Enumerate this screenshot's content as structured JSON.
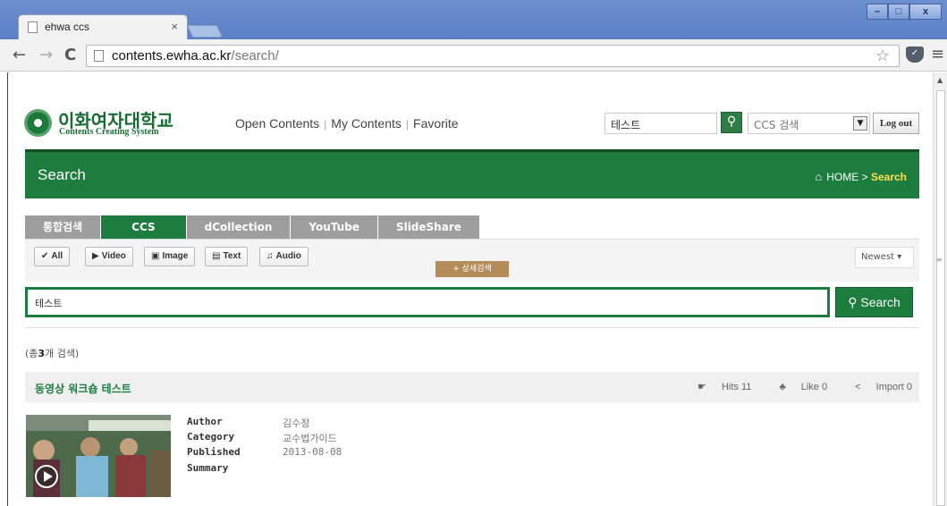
{
  "browser": {
    "tab_title": "ehwa ccs",
    "tab_close": "×",
    "url_host": "contents.ewha.ac.kr",
    "url_path": "/search/",
    "window_min": "–",
    "window_max": "□",
    "window_close": "x",
    "back": "←",
    "forward": "→",
    "reload": "C",
    "star": "☆",
    "menu": "≡"
  },
  "header": {
    "logo_kr": "이화여자대학교",
    "logo_en": "Contents Creating System",
    "nav": [
      "Open Contents",
      "My Contents",
      "Favorite"
    ],
    "search_value": "테스트",
    "select_value": "CCS 검색",
    "logout": "Log out"
  },
  "banner": {
    "title": "Search",
    "crumb_home": "HOME",
    "crumb_sep": ">",
    "crumb_current": "Search"
  },
  "tabs": [
    "통합검색",
    "CCS",
    "dCollection",
    "YouTube",
    "SlideShare"
  ],
  "active_tab": "CCS",
  "filters": [
    {
      "icon": "✔",
      "label": "All"
    },
    {
      "icon": "▶",
      "label": "Video"
    },
    {
      "icon": "▣",
      "label": "Image"
    },
    {
      "icon": "▤",
      "label": "Text"
    },
    {
      "icon": "♫",
      "label": "Audio"
    }
  ],
  "sort": "Newest",
  "detail_search": "+ 상세검색",
  "search": {
    "value": "테스트",
    "button": "Search"
  },
  "result_count": {
    "prefix": "(총",
    "count": "3",
    "suffix": "개 검색)"
  },
  "result": {
    "title": "동영상 워크숍 테스트",
    "hits": "Hits 11",
    "like": "Like 0",
    "import": "Import 0",
    "labels": [
      "Author",
      "Category",
      "Published",
      "Summary"
    ],
    "author": "김수정",
    "category": "교수법가이드",
    "published": "2013-08-08",
    "summary": ""
  },
  "colors": {
    "brand_green": "#1c7d3f",
    "tab_gray": "#9e9e9e",
    "accent_yellow": "#ffe04a"
  }
}
